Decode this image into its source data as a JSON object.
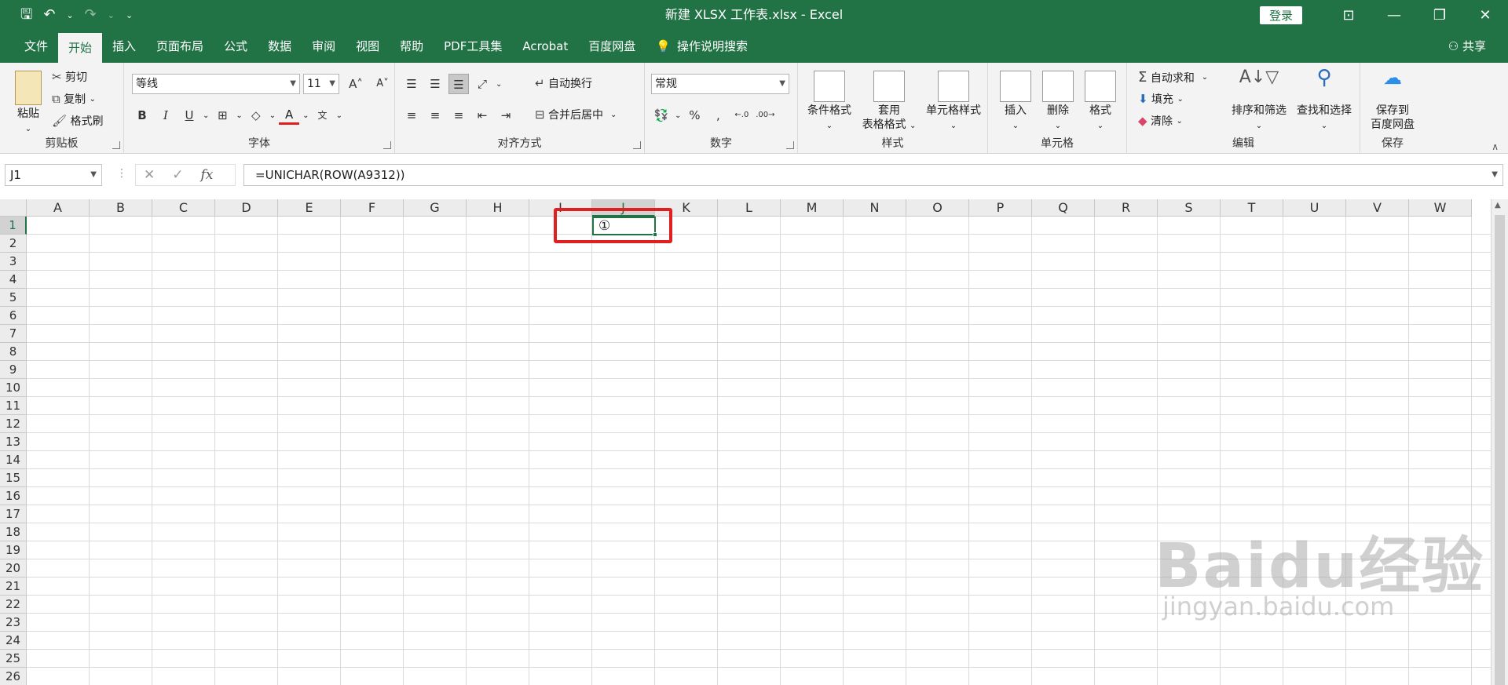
{
  "window": {
    "title": "新建 XLSX 工作表.xlsx  -  Excel",
    "login_label": "登录",
    "share_label": "共享"
  },
  "tabs": [
    "文件",
    "开始",
    "插入",
    "页面布局",
    "公式",
    "数据",
    "审阅",
    "视图",
    "帮助",
    "PDF工具集",
    "Acrobat",
    "百度网盘"
  ],
  "tell_me": "操作说明搜索",
  "clipboard": {
    "group_label": "剪贴板",
    "paste": "粘贴",
    "cut": "剪切",
    "copy": "复制",
    "format_painter": "格式刷"
  },
  "font": {
    "group_label": "字体",
    "name": "等线",
    "size": "11",
    "grow": "A˄",
    "shrink": "A˅",
    "bold": "B",
    "italic": "I",
    "underline": "U",
    "phonetic": "文"
  },
  "alignment": {
    "group_label": "对齐方式",
    "wrap_text": "自动换行",
    "merge_center": "合并后居中"
  },
  "number": {
    "group_label": "数字",
    "format": "常规",
    "percent": "%",
    "comma": ","
  },
  "styles": {
    "group_label": "样式",
    "conditional": "条件格式",
    "table_line1": "套用",
    "table_line2": "表格格式",
    "cell_styles": "单元格样式"
  },
  "cells": {
    "group_label": "单元格",
    "insert": "插入",
    "delete": "删除",
    "format": "格式"
  },
  "editing": {
    "group_label": "编辑",
    "autosum": "自动求和",
    "fill": "填充",
    "clear": "清除",
    "sort_filter": "排序和筛选",
    "find_select": "查找和选择"
  },
  "save": {
    "group_label": "保存",
    "line1": "保存到",
    "line2": "百度网盘"
  },
  "formula_bar": {
    "name_box": "J1",
    "formula": "=UNICHAR(ROW(A9312))",
    "cancel": "✕",
    "enter": "✓",
    "fx": "fx"
  },
  "sheet": {
    "columns": [
      "A",
      "B",
      "C",
      "D",
      "E",
      "F",
      "G",
      "H",
      "I",
      "J",
      "K",
      "L",
      "M",
      "N",
      "O",
      "P",
      "Q",
      "R",
      "S",
      "T",
      "U",
      "V",
      "W"
    ],
    "rows": [
      "1",
      "2",
      "3",
      "4",
      "5",
      "6",
      "7",
      "8",
      "9",
      "10",
      "11",
      "12",
      "13",
      "14",
      "15",
      "16",
      "17",
      "18",
      "19",
      "20",
      "21",
      "22",
      "23",
      "24",
      "25",
      "26"
    ],
    "active_cell_value": "①",
    "selected_column": "J",
    "selected_row": "1"
  },
  "watermark": {
    "line1": "Baidu经验",
    "line2": "jingyan.baidu.com"
  },
  "colors": {
    "brand": "#217346",
    "highlight": "#e02020"
  }
}
